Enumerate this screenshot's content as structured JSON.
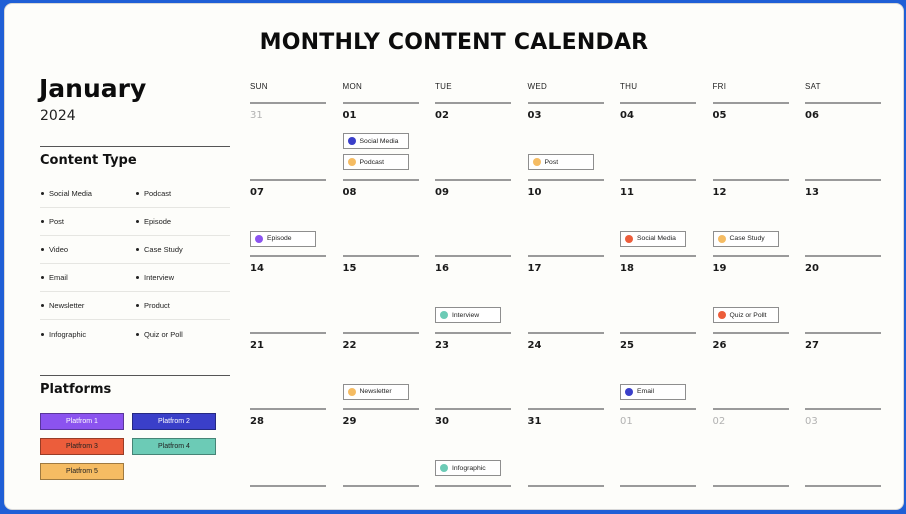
{
  "title": "MONTHLY CONTENT CALENDAR",
  "sidebar": {
    "month": "January",
    "year": "2024",
    "content_type_title": "Content Type",
    "content_types": [
      [
        "Social Media",
        "Podcast"
      ],
      [
        "Post",
        "Episode"
      ],
      [
        "Video",
        "Case Study"
      ],
      [
        "Email",
        "Interview"
      ],
      [
        "Newsletter",
        "Product"
      ],
      [
        "Infographic",
        "Quiz or Poll"
      ]
    ],
    "platforms_title": "Platforms",
    "platforms": [
      {
        "label": "Platfrom 1",
        "color": "#8b53ef",
        "text": "#ffffff"
      },
      {
        "label": "Platfrom 2",
        "color": "#3a3fc9",
        "text": "#ffffff"
      },
      {
        "label": "Platfrom 3",
        "color": "#ec5d3b",
        "text": "#222222"
      },
      {
        "label": "Platfrom 4",
        "color": "#6ccbb6",
        "text": "#222222"
      },
      {
        "label": "Platfrom 5",
        "color": "#f5bc63",
        "text": "#222222"
      }
    ]
  },
  "calendar": {
    "weekdays": [
      "SUN",
      "MON",
      "TUE",
      "WED",
      "THU",
      "FRI",
      "SAT"
    ],
    "weeks": [
      [
        {
          "d": "31",
          "muted": true
        },
        {
          "d": "01"
        },
        {
          "d": "02"
        },
        {
          "d": "03"
        },
        {
          "d": "04"
        },
        {
          "d": "05"
        },
        {
          "d": "06"
        }
      ],
      [
        {
          "d": "07"
        },
        {
          "d": "08"
        },
        {
          "d": "09"
        },
        {
          "d": "10"
        },
        {
          "d": "11"
        },
        {
          "d": "12"
        },
        {
          "d": "13"
        }
      ],
      [
        {
          "d": "14"
        },
        {
          "d": "15"
        },
        {
          "d": "16"
        },
        {
          "d": "17"
        },
        {
          "d": "18"
        },
        {
          "d": "19"
        },
        {
          "d": "20"
        }
      ],
      [
        {
          "d": "21"
        },
        {
          "d": "22"
        },
        {
          "d": "23"
        },
        {
          "d": "24"
        },
        {
          "d": "25"
        },
        {
          "d": "26"
        },
        {
          "d": "27"
        }
      ],
      [
        {
          "d": "28"
        },
        {
          "d": "29"
        },
        {
          "d": "30"
        },
        {
          "d": "31"
        },
        {
          "d": "01",
          "muted": true
        },
        {
          "d": "02",
          "muted": true
        },
        {
          "d": "03",
          "muted": true
        }
      ]
    ],
    "events": [
      {
        "week": 0,
        "day": 1,
        "slot": 0,
        "label": "Social Media",
        "color": "#3a3fc9"
      },
      {
        "week": 0,
        "day": 1,
        "slot": 1,
        "label": "Podcast",
        "color": "#f5bc63"
      },
      {
        "week": 0,
        "day": 3,
        "slot": 1,
        "label": "Post",
        "color": "#f5bc63"
      },
      {
        "week": 1,
        "day": 0,
        "slot": 1,
        "label": "Episode",
        "color": "#8b53ef"
      },
      {
        "week": 1,
        "day": 4,
        "slot": 1,
        "label": "Social Media",
        "color": "#ec5d3b"
      },
      {
        "week": 1,
        "day": 5,
        "slot": 1,
        "label": "Case Study",
        "color": "#f5bc63"
      },
      {
        "week": 2,
        "day": 2,
        "slot": 1,
        "label": "Interview",
        "color": "#6ccbb6"
      },
      {
        "week": 2,
        "day": 5,
        "slot": 1,
        "label": "Quiz or Pollt",
        "color": "#ec5d3b"
      },
      {
        "week": 3,
        "day": 1,
        "slot": 1,
        "label": "Newsletter",
        "color": "#f5bc63"
      },
      {
        "week": 3,
        "day": 4,
        "slot": 1,
        "label": "Email",
        "color": "#3a3fc9"
      },
      {
        "week": 4,
        "day": 2,
        "slot": 1,
        "label": "Infographic",
        "color": "#6ccbb6"
      }
    ]
  }
}
